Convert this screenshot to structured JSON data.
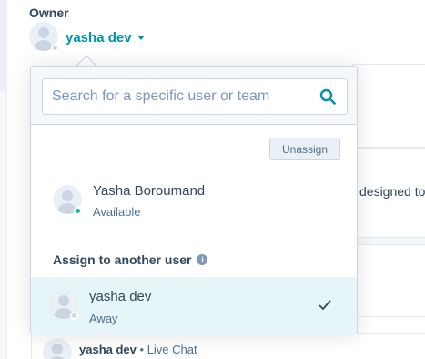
{
  "owner": {
    "label": "Owner",
    "name": "yasha dev"
  },
  "background": {
    "snippet": "designed to",
    "row_name": "yasha dev",
    "row_separator": "•",
    "row_channel": "Live Chat"
  },
  "dropdown": {
    "search": {
      "placeholder": "Search for a specific user or team",
      "value": ""
    },
    "unassign_label": "Unassign",
    "current_user": {
      "name": "Yasha Boroumand",
      "status": "Available",
      "status_color": "#00bda5"
    },
    "section_header": "Assign to another user",
    "info_icon": "i",
    "other_user": {
      "name": "yasha dev",
      "status": "Away",
      "selected": true
    }
  },
  "colors": {
    "accent": "#0091ae",
    "text": "#33475b",
    "selected_bg": "#e5f5f8"
  }
}
